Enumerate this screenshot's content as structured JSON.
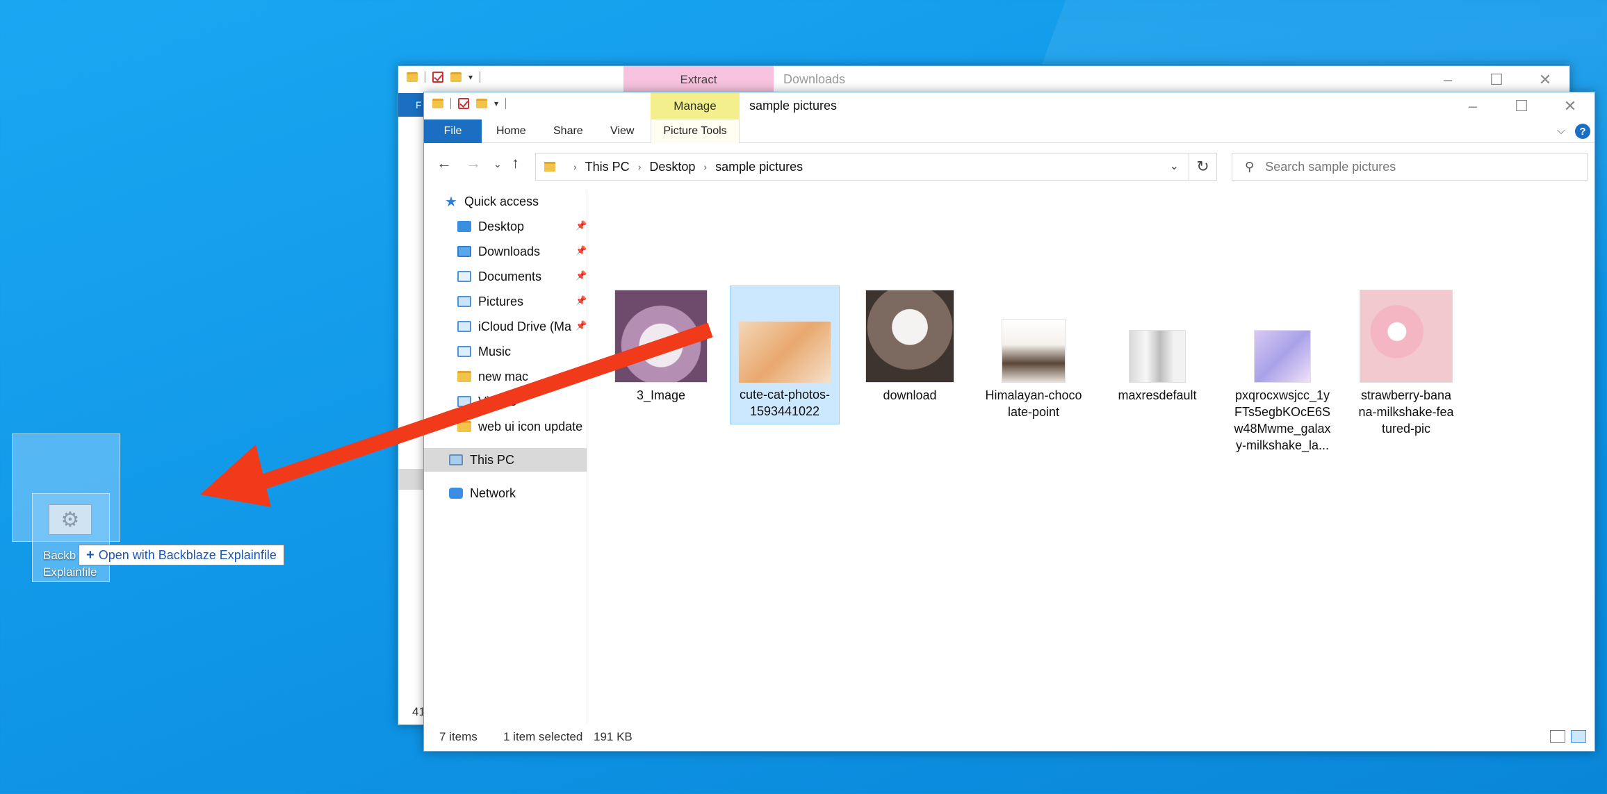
{
  "back_window": {
    "context_tab_label": "Extract",
    "title": "Downloads",
    "file_tab": "F",
    "status_count": "41"
  },
  "front_window": {
    "context_tab_label": "Manage",
    "title": "sample pictures",
    "ribbon_tabs": [
      "File",
      "Home",
      "Share",
      "View",
      "Picture Tools"
    ],
    "address": {
      "crumbs": [
        "This PC",
        "Desktop",
        "sample pictures"
      ]
    },
    "search": {
      "placeholder": "Search sample pictures"
    },
    "sidebar": {
      "quick_access": "Quick access",
      "items": [
        {
          "label": "Desktop",
          "icon": "desktop-icon",
          "pinned": true
        },
        {
          "label": "Downloads",
          "icon": "downloads-icon",
          "pinned": true
        },
        {
          "label": "Documents",
          "icon": "documents-icon",
          "pinned": true
        },
        {
          "label": "Pictures",
          "icon": "pictures-icon",
          "pinned": true
        },
        {
          "label": "iCloud Drive (Ma",
          "icon": "icloud-icon",
          "pinned": true
        },
        {
          "label": "Music",
          "icon": "music-icon",
          "pinned": false
        },
        {
          "label": "new                 mac",
          "icon": "folder-icon",
          "pinned": false
        },
        {
          "label": "Videos",
          "icon": "videos-icon",
          "pinned": false
        },
        {
          "label": "web ui icon update",
          "icon": "folder-icon",
          "pinned": false
        }
      ],
      "this_pc": "This PC",
      "network": "Network"
    },
    "files": [
      {
        "name": "3_Image"
      },
      {
        "name": "cute-cat-photos-1593441022",
        "line1": "cute-cat-photos-",
        "line2": "1593441022",
        "selected": true
      },
      {
        "name": "download"
      },
      {
        "name": "Himalayan-chocolate-point",
        "line1": "Himalayan-choco",
        "line2": "late-point"
      },
      {
        "name": "maxresdefault"
      },
      {
        "name": "pxqrocxwsjcc_1yFTs5egbKOcE6Sw48Mwme_galaxy-milkshake_la...",
        "line1": "pxqrocxwsjcc_1y",
        "line2": "FTs5egbKOcE6S",
        "line3": "w48Mwme_galax",
        "line4": "y-milkshake_la..."
      },
      {
        "name": "strawberry-banana-milkshake-featured-pic",
        "line1": "strawberry-bana",
        "line2": "na-milkshake-fea",
        "line3": "tured-pic"
      }
    ],
    "status": {
      "items": "7 items",
      "selection": "1 item selected",
      "size": "191 KB"
    }
  },
  "desktop_drag": {
    "ghost_line1": "Backb",
    "ghost_line2": "Explainfile",
    "tooltip": "Open with Backblaze Explainfile",
    "annotation_color": "#f03a1a"
  }
}
